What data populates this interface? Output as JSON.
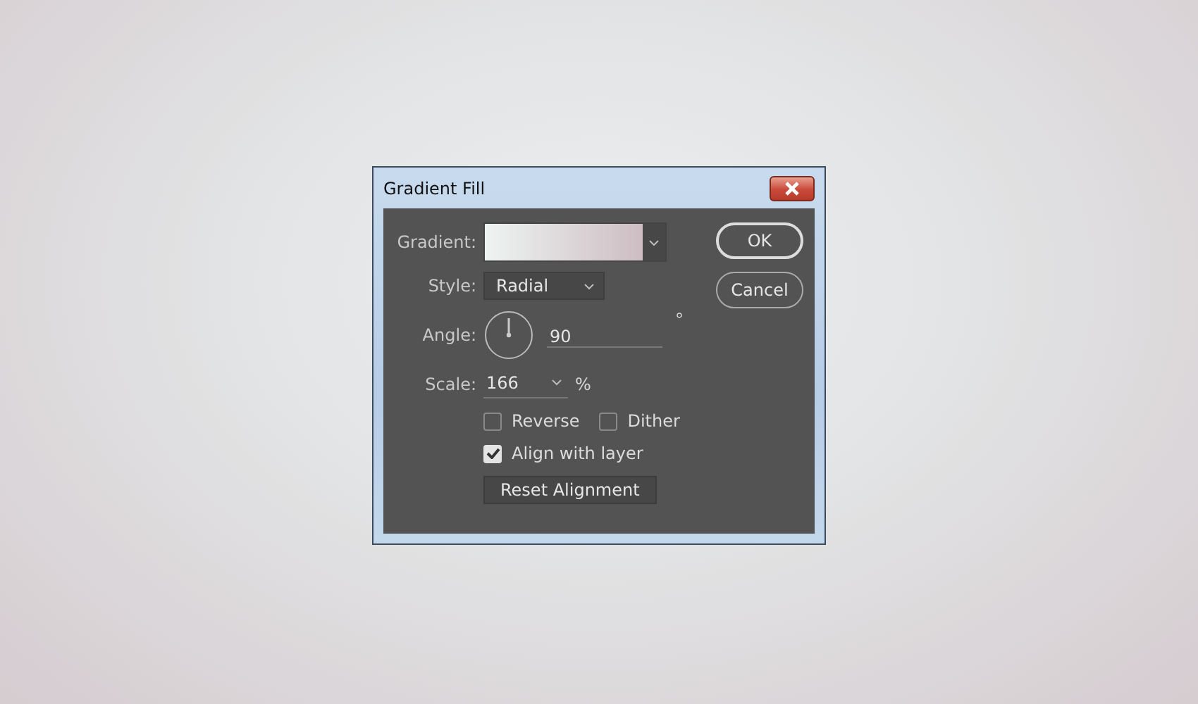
{
  "window": {
    "title": "Gradient Fill"
  },
  "gradient": {
    "label": "Gradient:"
  },
  "style": {
    "label": "Style:",
    "value": "Radial"
  },
  "angle": {
    "label": "Angle:",
    "value": "90",
    "unit": "°"
  },
  "scale": {
    "label": "Scale:",
    "value": "166",
    "unit": "%"
  },
  "options": [
    {
      "label": "Reverse",
      "checked": false
    },
    {
      "label": "Dither",
      "checked": false
    }
  ],
  "align": {
    "label": "Align with layer",
    "checked": true
  },
  "reset_button": "Reset Alignment",
  "buttons": [
    {
      "label": "OK",
      "kind": "default"
    },
    {
      "label": "Cancel",
      "kind": "normal"
    }
  ]
}
